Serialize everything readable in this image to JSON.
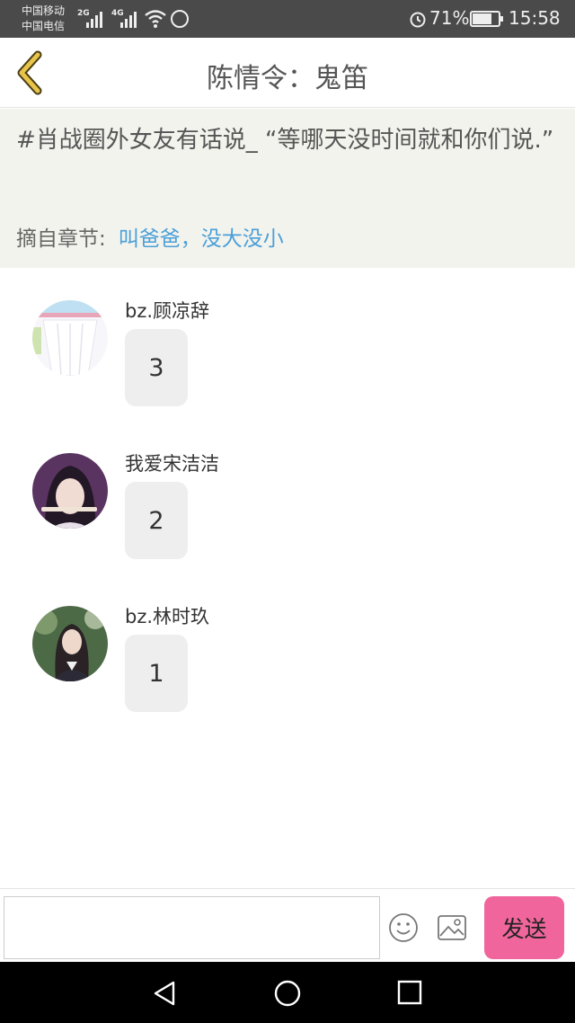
{
  "status": {
    "carrier1": "中国移动",
    "carrier2": "中国电信",
    "net1": "2G",
    "net2": "4G",
    "battery": "71%",
    "battery_level": 0.71,
    "time": "15:58"
  },
  "header": {
    "title": "陈情令：鬼笛",
    "back_icon": "chevron-left-icon"
  },
  "quote": {
    "text": "#肖战圈外女友有话说_ “等哪天没时间就和你们说.”",
    "chapter_label": "摘自章节:",
    "chapter_link": "叫爸爸，没大没小"
  },
  "replies": [
    {
      "user": "bz.顾凉辞",
      "content": "3"
    },
    {
      "user": "我爱宋洁洁",
      "content": "2"
    },
    {
      "user": "bz.林时玖",
      "content": "1"
    }
  ],
  "input": {
    "placeholder": "",
    "send_label": "发送",
    "emoji_icon": "smiley-icon",
    "image_icon": "image-icon"
  },
  "colors": {
    "accent": "#f0669c",
    "link": "#4a9fd8",
    "back_chevron": "#e8c54a"
  }
}
